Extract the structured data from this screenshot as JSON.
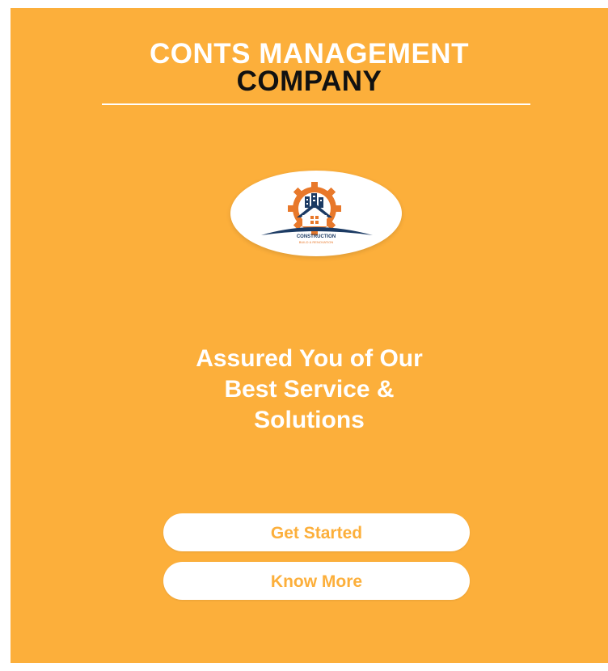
{
  "header": {
    "title_line1": "CONTS MANAGEMENT",
    "title_line2": "COMPANY"
  },
  "logo": {
    "icon": "construction-house-gear-logo",
    "text_main": "CONSTRUCTION",
    "text_sub": "BUILD & RENOVATION"
  },
  "hero": {
    "tagline_line1": "Assured You of Our",
    "tagline_line2": "Best Service &",
    "tagline_line3": "Solutions"
  },
  "actions": {
    "get_started_label": "Get Started",
    "know_more_label": "Know More"
  },
  "colors": {
    "background": "#fcaf3b",
    "title_primary": "#ffffff",
    "title_secondary": "#111111",
    "button_background": "#ffffff",
    "button_text": "#fcaf3b",
    "logo_gear": "#e8782a",
    "logo_navy": "#1b3a63"
  }
}
